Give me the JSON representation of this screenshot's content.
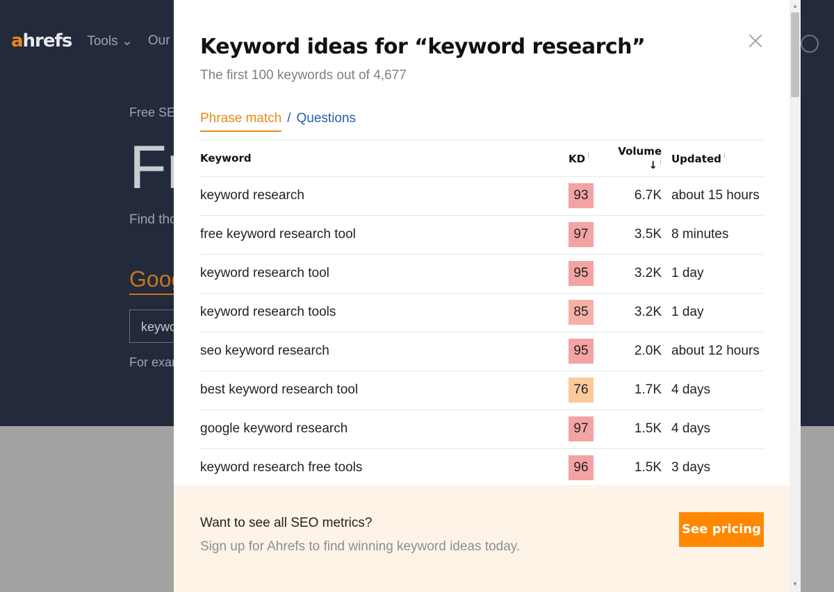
{
  "background": {
    "logo_a": "a",
    "logo_rest": "hrefs",
    "nav": [
      "Tools ⌄",
      "Our dat"
    ],
    "free_text": "Free SE",
    "big_text": "Fr",
    "find_text": "Find tho",
    "google_text": "Goog",
    "input_text": "keywo",
    "example_text": "For exan"
  },
  "modal": {
    "title": "Keyword ideas for “keyword research”",
    "subtitle": "The first 100 keywords out of 4,677",
    "tabs": {
      "active": "Phrase match",
      "separator": "/",
      "other": "Questions"
    },
    "close_icon": "×",
    "columns": {
      "keyword": "Keyword",
      "kd": "KD",
      "volume": "Volume ↓",
      "updated": "Updated",
      "info": "i"
    },
    "rows": [
      {
        "keyword": "keyword research",
        "kd": "93",
        "volume": "6.7K",
        "updated": "about 15 hours",
        "kd_color": "#f4a3a3"
      },
      {
        "keyword": "free keyword research tool",
        "kd": "97",
        "volume": "3.5K",
        "updated": "8 minutes",
        "kd_color": "#f4a3a3"
      },
      {
        "keyword": "keyword research tool",
        "kd": "95",
        "volume": "3.2K",
        "updated": "1 day",
        "kd_color": "#f4a3a3"
      },
      {
        "keyword": "keyword research tools",
        "kd": "85",
        "volume": "3.2K",
        "updated": "1 day",
        "kd_color": "#f7b0a6"
      },
      {
        "keyword": "seo keyword research",
        "kd": "95",
        "volume": "2.0K",
        "updated": "about 12 hours",
        "kd_color": "#f4a3a3"
      },
      {
        "keyword": "best keyword research tool",
        "kd": "76",
        "volume": "1.7K",
        "updated": "4 days",
        "kd_color": "#fbc99c"
      },
      {
        "keyword": "google keyword research",
        "kd": "97",
        "volume": "1.5K",
        "updated": "4 days",
        "kd_color": "#f4a3a3"
      },
      {
        "keyword": "keyword research free tools",
        "kd": "96",
        "volume": "1.5K",
        "updated": "3 days",
        "kd_color": "#f4a3a3"
      }
    ],
    "promo": {
      "title": "Want to see all SEO metrics?",
      "subtitle": "Sign up for Ahrefs to find winning keyword ideas today.",
      "button": "See pricing"
    }
  },
  "colors": {
    "accent": "#ff8800",
    "tab_active": "#e98a17",
    "link": "#1f5fa8"
  }
}
